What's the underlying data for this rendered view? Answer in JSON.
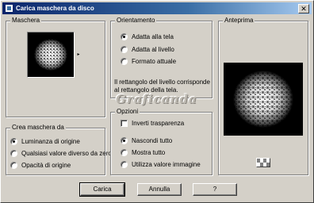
{
  "window": {
    "title": "Carica maschera da disco",
    "close_glyph": "✕"
  },
  "mask_group": {
    "label": "Maschera",
    "dropdown_glyph": "▸"
  },
  "orientation_group": {
    "label": "Orientamento",
    "options": [
      {
        "label": "Adatta alla tela",
        "checked": true
      },
      {
        "label": "Adatta al livello",
        "checked": false
      },
      {
        "label": "Formato attuale",
        "checked": false
      }
    ],
    "description": "Il rettangolo del livello corrisponde al rettangolo della tela."
  },
  "preview_group": {
    "label": "Anteprima"
  },
  "create_group": {
    "label": "Crea maschera da",
    "options": [
      {
        "label": "Luminanza di origine",
        "checked": true
      },
      {
        "label": "Qualsiasi valore diverso da zero",
        "checked": false
      },
      {
        "label": "Opacità di origine",
        "checked": false
      }
    ]
  },
  "options_group": {
    "label": "Opzioni",
    "invert_label": "Inverti trasparenza",
    "invert_checked": false,
    "options": [
      {
        "label": "Nascondi tutto",
        "checked": true
      },
      {
        "label": "Mostra tutto",
        "checked": false
      },
      {
        "label": "Utilizza valore immagine",
        "checked": false
      }
    ]
  },
  "watermark": "Graficanda",
  "buttons": {
    "load": "Carica",
    "cancel": "Annulla",
    "help": "?"
  }
}
